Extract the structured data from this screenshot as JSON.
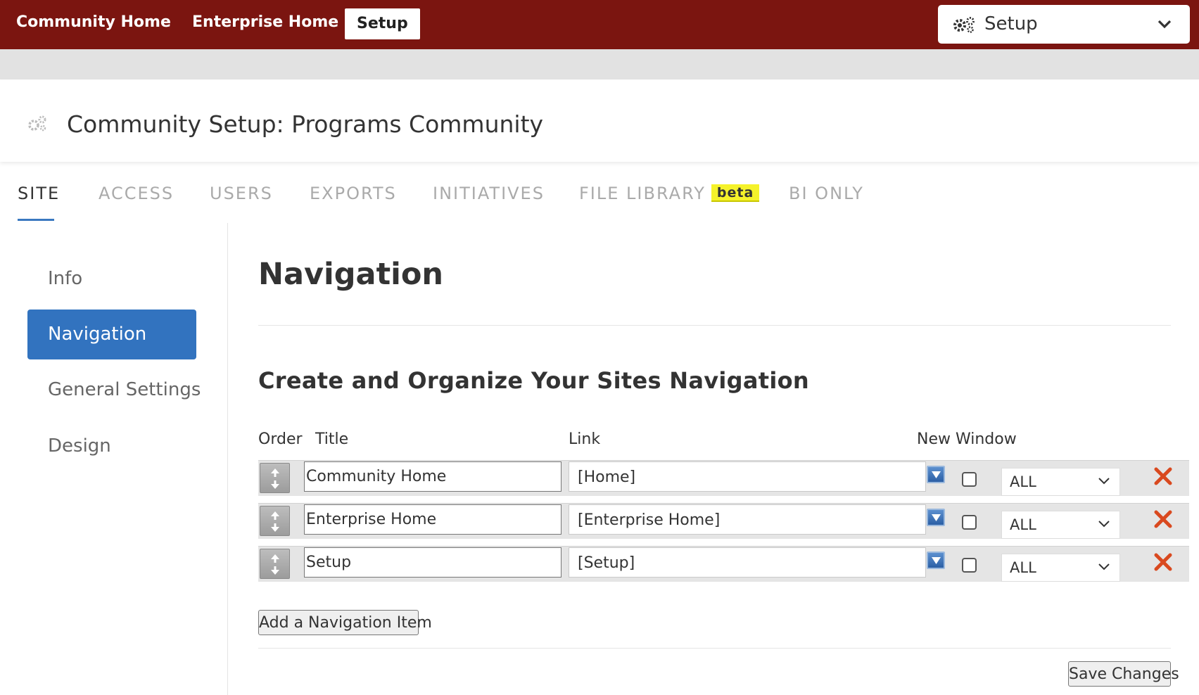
{
  "topnav": {
    "items": [
      {
        "label": "Community Home"
      },
      {
        "label": "Enterprise Home"
      },
      {
        "label": "Setup"
      }
    ],
    "setup_dropdown": {
      "label": "Setup",
      "icon": "gears-icon"
    }
  },
  "page": {
    "title": "Community Setup: Programs Community",
    "icon": "gears-icon"
  },
  "tabs": [
    {
      "label": "SITE"
    },
    {
      "label": "ACCESS"
    },
    {
      "label": "USERS"
    },
    {
      "label": "EXPORTS"
    },
    {
      "label": "INITIATIVES"
    },
    {
      "label": "FILE LIBRARY",
      "badge": "beta"
    },
    {
      "label": "BI ONLY"
    }
  ],
  "sidebar": {
    "items": [
      {
        "label": "Info"
      },
      {
        "label": "Navigation"
      },
      {
        "label": "General Settings"
      },
      {
        "label": "Design"
      }
    ]
  },
  "main": {
    "heading": "Navigation",
    "subheading": "Create and Organize Your Sites Navigation",
    "columns": {
      "order": "Order",
      "title": "Title",
      "link": "Link",
      "new_window": "New Window"
    },
    "rows": [
      {
        "title": "Community Home",
        "link": "[Home]",
        "new_window": false,
        "access": "ALL"
      },
      {
        "title": "Enterprise Home",
        "link": "[Enterprise Home]",
        "new_window": false,
        "access": "ALL"
      },
      {
        "title": "Setup",
        "link": "[Setup]",
        "new_window": false,
        "access": "ALL"
      }
    ],
    "add_button": "Add a Navigation Item",
    "save_button": "Save Changes"
  },
  "colors": {
    "topbar": "#7b1510",
    "accent": "#3273bf",
    "beta_badge": "#f5f22a",
    "delete": "#d9491f"
  }
}
